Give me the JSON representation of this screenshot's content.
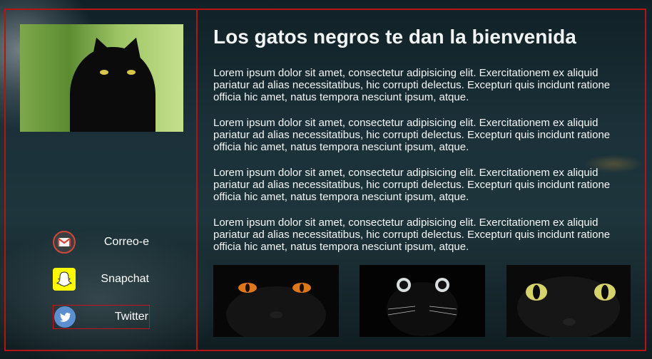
{
  "sidebar": {
    "profile_photo_alt": "gato negro",
    "social": [
      {
        "label": "Correo-e",
        "icon": "gmail-icon",
        "color": "#d44638"
      },
      {
        "label": "Snapchat",
        "icon": "snapchat-ghost-icon",
        "color": "#fffc00"
      },
      {
        "label": "Twitter",
        "icon": "twitter-bird-icon",
        "color": "#5b8fd0"
      }
    ]
  },
  "main": {
    "title": "Los gatos negros te dan la bienvenida",
    "paragraphs": [
      "Lorem ipsum dolor sit amet, consectetur adipisicing elit. Exercitationem ex aliquid pariatur ad alias necessitatibus, hic corrupti delectus. Excepturi quis incidunt ratione officia hic amet, natus tempora nesciunt ipsum, atque.",
      "Lorem ipsum dolor sit amet, consectetur adipisicing elit. Exercitationem ex aliquid pariatur ad alias necessitatibus, hic corrupti delectus. Excepturi quis incidunt ratione officia hic amet, natus tempora nesciunt ipsum, atque.",
      "Lorem ipsum dolor sit amet, consectetur adipisicing elit. Exercitationem ex aliquid pariatur ad alias necessitatibus, hic corrupti delectus. Excepturi quis incidunt ratione officia hic amet, natus tempora nesciunt ipsum, atque.",
      "Lorem ipsum dolor sit amet, consectetur adipisicing elit. Exercitationem ex aliquid pariatur ad alias necessitatibus, hic corrupti delectus. Excepturi quis incidunt ratione officia hic amet, natus tempora nesciunt ipsum, atque."
    ],
    "gallery": [
      {
        "eye_color": "#e0761a"
      },
      {
        "eye_color": "#e8edf0"
      },
      {
        "eye_color": "#d6d36a"
      }
    ]
  },
  "colors": {
    "border": "#b51414",
    "accent_active": "#c4141a"
  }
}
